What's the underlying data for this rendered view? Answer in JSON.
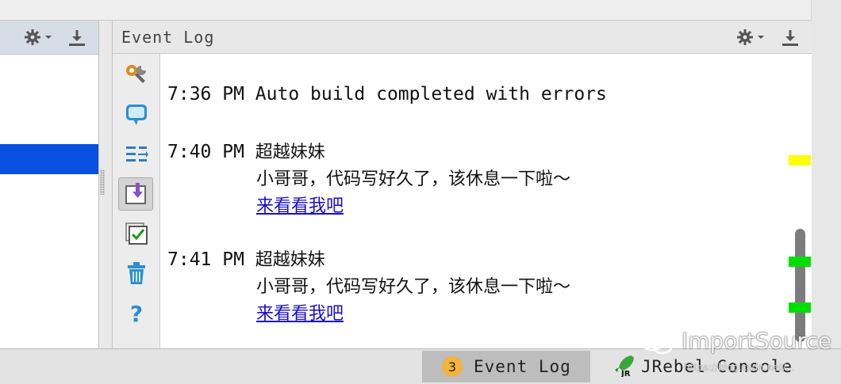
{
  "event_log": {
    "title": "Event Log",
    "entries": [
      {
        "time": "7:36 PM",
        "message": "Auto build completed with errors"
      },
      {
        "time": "7:40 PM",
        "title": "超越妹妹",
        "body": "小哥哥，代码写好久了，该休息一下啦～",
        "link": "来看看我吧"
      },
      {
        "time": "7:41 PM",
        "title": "超越妹妹",
        "body": "小哥哥，代码写好久了，该休息一下啦～",
        "link": "来看看我吧"
      }
    ]
  },
  "toolbar_icons": [
    "settings-wrench-icon",
    "balloon-icon",
    "soft-wrap-icon",
    "scroll-to-end-icon",
    "mark-read-icon",
    "trash-icon",
    "help-icon"
  ],
  "bottom_bar": {
    "event_log_tab": {
      "count": "3",
      "label": "Event Log"
    },
    "jrebel_tab": {
      "label": "JRebel Console"
    }
  },
  "watermark": {
    "text": "ImportSource",
    "url": "https://blog.csdn.net/..."
  },
  "colors": {
    "selection": "#0a50e0",
    "link": "#1a0dcc",
    "warning_marker": "#ffff00",
    "ok_marker": "#00dd00",
    "badge": "#f3b33d"
  }
}
